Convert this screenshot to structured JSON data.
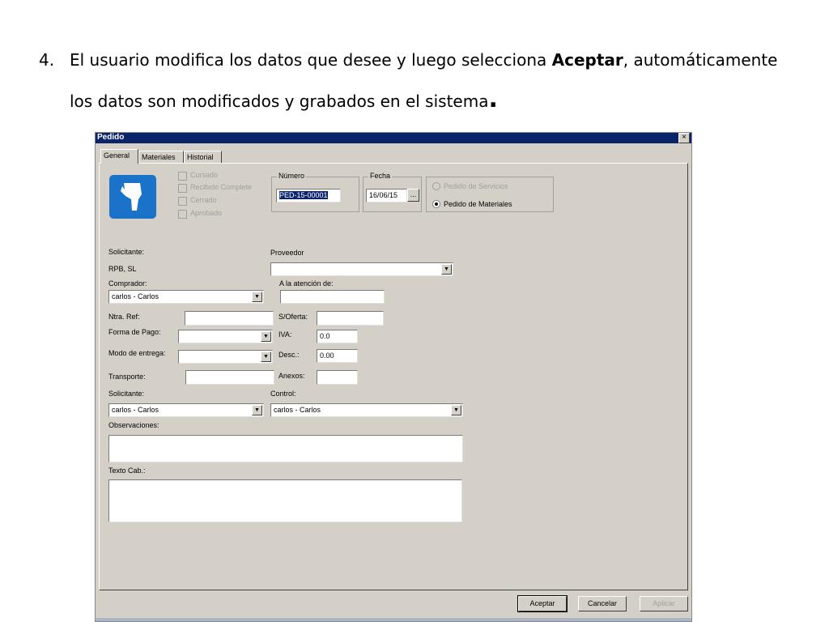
{
  "slide": {
    "step_number": "4.",
    "line1_a": "El usuario modifica los datos que desee y luego selecciona ",
    "line1_bold": "Aceptar",
    "line1_b": ", automáticamente",
    "line2": "los datos son modificados y grabados en el sistema",
    "line2_end": "."
  },
  "window": {
    "title": "Pedido",
    "close": "×",
    "tabs": [
      {
        "label": "General"
      },
      {
        "label": "Materiales"
      },
      {
        "label": "Historial"
      }
    ],
    "status_checks": [
      {
        "label": "Cursado"
      },
      {
        "label": "Recibido Complete"
      },
      {
        "label": "Cerrado"
      },
      {
        "label": "Aprobado"
      }
    ],
    "numero": {
      "label": "Número",
      "value": "PED-15-00001"
    },
    "fecha": {
      "label": "Fecha",
      "value": "16/06/15",
      "button": "..."
    },
    "tipo": {
      "servicios": "Pedido de Servicios",
      "materiales": "Pedido de Materiales"
    },
    "solicitante_label": "Solicitante:",
    "solicitante_value": "RPB, SL",
    "proveedor_label": "Proveedor",
    "proveedor_value": "",
    "comprador_label": "Comprador:",
    "comprador_value": "carlos - Carlos",
    "atencion_label": "A la atención de:",
    "atencion_value": "",
    "ntra_ref_label": "Ntra. Ref:",
    "ntra_ref_value": "",
    "soferta_label": "S/Oferta:",
    "soferta_value": "",
    "forma_pago_label": "Forma de Pago:",
    "forma_pago_value": "",
    "iva_label": "IVA:",
    "iva_value": "0.0",
    "modo_entrega_label": "Modo de entrega:",
    "modo_entrega_value": "",
    "desc_label": "Desc.:",
    "desc_value": "0.00",
    "transporte_label": "Transporte:",
    "transporte_value": "",
    "anexos_label": "Anexos:",
    "anexos_value": "",
    "solicitante2_label": "Solicitante:",
    "solicitante2_value": "carlos - Carlos",
    "control_label": "Control:",
    "control_value": "carlos - Carlos",
    "observaciones_label": "Observaciones:",
    "observaciones_value": "",
    "texto_cab_label": "Texto Cab.:",
    "texto_cab_value": "",
    "buttons": {
      "aceptar": "Aceptar",
      "cancelar": "Cancelar",
      "aplicar": "Aplicar"
    },
    "dropdown_arrow": "▼"
  }
}
